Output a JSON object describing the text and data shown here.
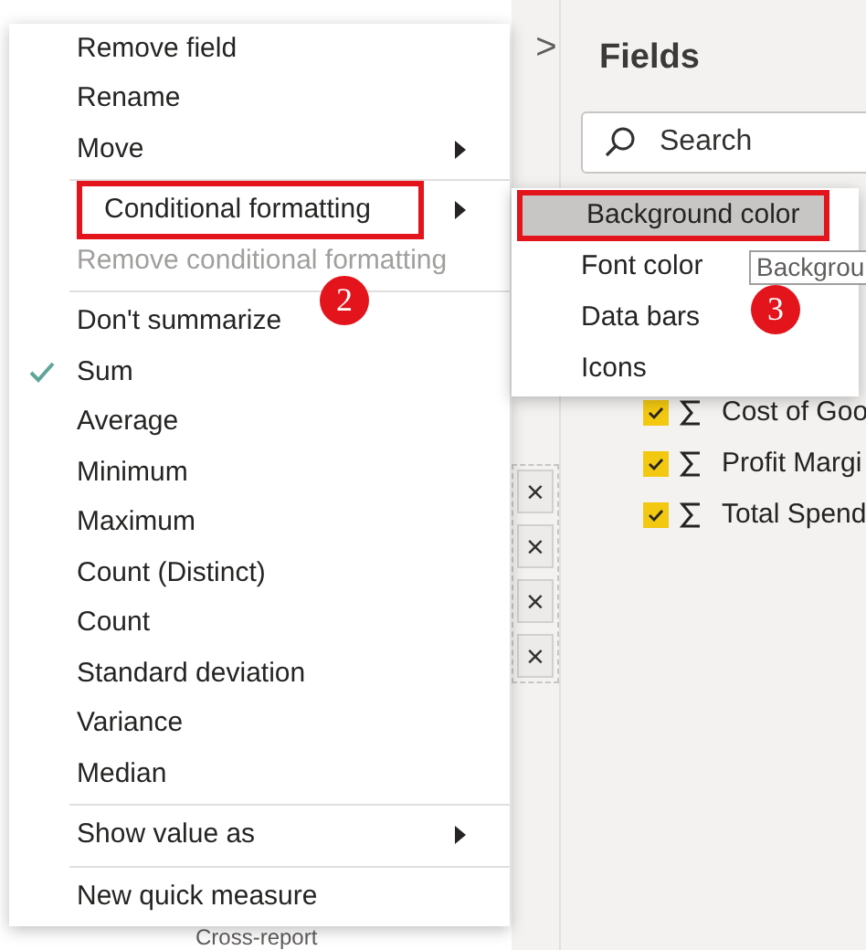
{
  "fields_pane": {
    "title": "Fields",
    "collapse_glyph": ">",
    "search": {
      "placeholder": "Search"
    },
    "fields": [
      {
        "label": "Cost of Goo",
        "checked": true
      },
      {
        "label": "Profit Margi",
        "checked": true
      },
      {
        "label": "Total Spend",
        "checked": true
      }
    ]
  },
  "well_items": [
    {
      "remove_glyph": "×"
    },
    {
      "remove_glyph": "×"
    },
    {
      "remove_glyph": "×"
    },
    {
      "remove_glyph": "×"
    }
  ],
  "cross_report": "Cross-report",
  "context_menu": {
    "items": [
      {
        "kind": "item",
        "label": "Remove field",
        "checked": false,
        "disabled": false,
        "submenu": false,
        "highlighted": false
      },
      {
        "kind": "item",
        "label": "Rename",
        "checked": false,
        "disabled": false,
        "submenu": false,
        "highlighted": false
      },
      {
        "kind": "item",
        "label": "Move",
        "checked": false,
        "disabled": false,
        "submenu": true,
        "highlighted": false
      },
      {
        "kind": "separator"
      },
      {
        "kind": "item",
        "label": "Conditional formatting",
        "checked": false,
        "disabled": false,
        "submenu": true,
        "highlighted": true
      },
      {
        "kind": "item",
        "label": "Remove conditional formatting",
        "checked": false,
        "disabled": true,
        "submenu": false,
        "highlighted": false
      },
      {
        "kind": "separator"
      },
      {
        "kind": "item",
        "label": "Don't summarize",
        "checked": false,
        "disabled": false,
        "submenu": false,
        "highlighted": false
      },
      {
        "kind": "item",
        "label": "Sum",
        "checked": true,
        "disabled": false,
        "submenu": false,
        "highlighted": false
      },
      {
        "kind": "item",
        "label": "Average",
        "checked": false,
        "disabled": false,
        "submenu": false,
        "highlighted": false
      },
      {
        "kind": "item",
        "label": "Minimum",
        "checked": false,
        "disabled": false,
        "submenu": false,
        "highlighted": false
      },
      {
        "kind": "item",
        "label": "Maximum",
        "checked": false,
        "disabled": false,
        "submenu": false,
        "highlighted": false
      },
      {
        "kind": "item",
        "label": "Count (Distinct)",
        "checked": false,
        "disabled": false,
        "submenu": false,
        "highlighted": false
      },
      {
        "kind": "item",
        "label": "Count",
        "checked": false,
        "disabled": false,
        "submenu": false,
        "highlighted": false
      },
      {
        "kind": "item",
        "label": "Standard deviation",
        "checked": false,
        "disabled": false,
        "submenu": false,
        "highlighted": false
      },
      {
        "kind": "item",
        "label": "Variance",
        "checked": false,
        "disabled": false,
        "submenu": false,
        "highlighted": false
      },
      {
        "kind": "item",
        "label": "Median",
        "checked": false,
        "disabled": false,
        "submenu": false,
        "highlighted": false
      },
      {
        "kind": "separator"
      },
      {
        "kind": "item",
        "label": "Show value as",
        "checked": false,
        "disabled": false,
        "submenu": true,
        "highlighted": false
      },
      {
        "kind": "separator"
      },
      {
        "kind": "item",
        "label": "New quick measure",
        "checked": false,
        "disabled": false,
        "submenu": false,
        "highlighted": false
      }
    ]
  },
  "submenu": {
    "items": [
      {
        "label": "Background color",
        "selected": true,
        "highlighted": true
      },
      {
        "label": "Font color",
        "selected": false,
        "highlighted": false
      },
      {
        "label": "Data bars",
        "selected": false,
        "highlighted": false
      },
      {
        "label": "Icons",
        "selected": false,
        "highlighted": false
      }
    ]
  },
  "tooltip": "Backgrou",
  "callouts": [
    {
      "label": "2"
    },
    {
      "label": "3"
    }
  ]
}
